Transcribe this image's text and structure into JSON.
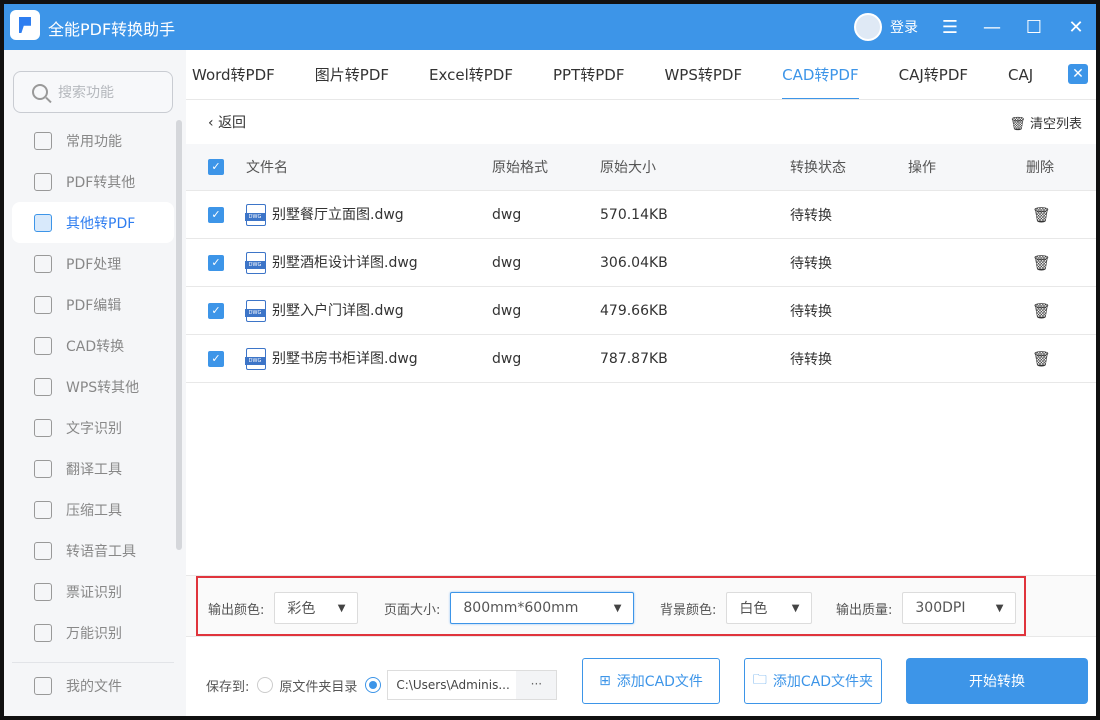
{
  "app": {
    "title": "全能PDF转换助手",
    "login": "登录"
  },
  "sidebar": {
    "search_placeholder": "搜索功能",
    "items": [
      {
        "label": "常用功能"
      },
      {
        "label": "PDF转其他"
      },
      {
        "label": "其他转PDF"
      },
      {
        "label": "PDF处理"
      },
      {
        "label": "PDF编辑"
      },
      {
        "label": "CAD转换"
      },
      {
        "label": "WPS转其他"
      },
      {
        "label": "文字识别"
      },
      {
        "label": "翻译工具"
      },
      {
        "label": "压缩工具"
      },
      {
        "label": "转语音工具"
      },
      {
        "label": "票证识别"
      },
      {
        "label": "万能识别"
      }
    ],
    "my_files": "我的文件"
  },
  "tabs": [
    "Word转PDF",
    "图片转PDF",
    "Excel转PDF",
    "PPT转PDF",
    "WPS转PDF",
    "CAD转PDF",
    "CAJ转PDF",
    "CAJ"
  ],
  "toolbar": {
    "back": "返回",
    "clear": "清空列表"
  },
  "table": {
    "headers": [
      "文件名",
      "原始格式",
      "原始大小",
      "转换状态",
      "操作",
      "删除"
    ],
    "rows": [
      {
        "name": "别墅餐厅立面图.dwg",
        "format": "dwg",
        "size": "570.14KB",
        "status": "待转换"
      },
      {
        "name": "别墅酒柜设计详图.dwg",
        "format": "dwg",
        "size": "306.04KB",
        "status": "待转换"
      },
      {
        "name": "别墅入户门详图.dwg",
        "format": "dwg",
        "size": "479.66KB",
        "status": "待转换"
      },
      {
        "name": "别墅书房书柜详图.dwg",
        "format": "dwg",
        "size": "787.87KB",
        "status": "待转换"
      }
    ]
  },
  "options": {
    "color_label": "输出颜色:",
    "color": "彩色",
    "page_label": "页面大小:",
    "page": "800mm*600mm",
    "bg_label": "背景颜色:",
    "bg": "白色",
    "quality_label": "输出质量:",
    "quality": "300DPI"
  },
  "bottom": {
    "save_to": "保存到:",
    "original_dir": "原文件夹目录",
    "path": "C:\\Users\\Adminis...",
    "dots": "···",
    "add_file": "添加CAD文件",
    "add_folder": "添加CAD文件夹",
    "start": "开始转换"
  },
  "icon_text": "DWG"
}
